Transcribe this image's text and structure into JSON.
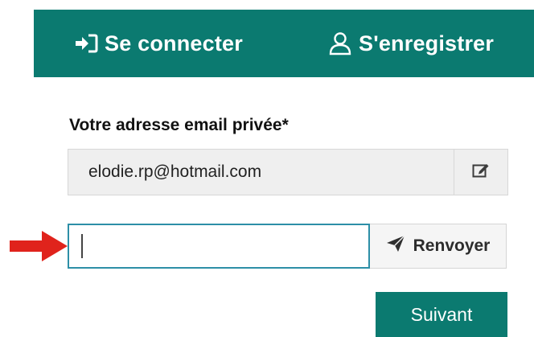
{
  "tabs": {
    "login": {
      "label": "Se connecter",
      "icon": "sign-in-icon"
    },
    "register": {
      "label": "S'enregistrer",
      "icon": "user-icon"
    }
  },
  "form": {
    "email_label": "Votre adresse email privée*",
    "email_value": "elodie.rp@hotmail.com",
    "edit_icon": "edit-icon",
    "code_input_value": "",
    "resend_label": "Renvoyer",
    "resend_icon": "paper-plane-icon",
    "next_label": "Suivant"
  },
  "annotation": {
    "arrow_color": "#e0231c",
    "arrow_icon": "red-arrow-icon"
  },
  "colors": {
    "accent": "#0b7a70",
    "input_focus_border": "#2d8fa7"
  }
}
